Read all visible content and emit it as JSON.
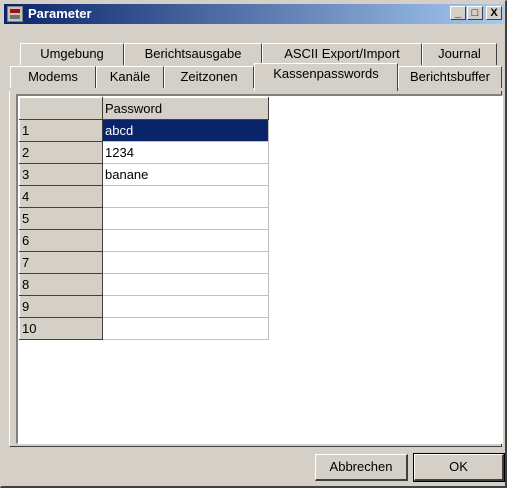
{
  "window": {
    "title": "Parameter",
    "minimize": "_",
    "maximize": "□",
    "close": "X"
  },
  "tabs_row1": [
    "Umgebung",
    "Berichtsausgabe",
    "ASCII Export/Import",
    "Journal"
  ],
  "tabs_row2": [
    "Modems",
    "Kanäle",
    "Zeitzonen",
    "Kassenpasswords",
    "Berichtsbuffer"
  ],
  "active_tab": "Kassenpasswords",
  "grid": {
    "header": "Password",
    "rows": [
      {
        "num": "1",
        "value": "abcd"
      },
      {
        "num": "2",
        "value": "1234"
      },
      {
        "num": "3",
        "value": "banane"
      },
      {
        "num": "4",
        "value": ""
      },
      {
        "num": "5",
        "value": ""
      },
      {
        "num": "6",
        "value": ""
      },
      {
        "num": "7",
        "value": ""
      },
      {
        "num": "8",
        "value": ""
      },
      {
        "num": "9",
        "value": ""
      },
      {
        "num": "10",
        "value": ""
      }
    ]
  },
  "buttons": {
    "cancel": "Abbrechen",
    "ok": "OK"
  }
}
